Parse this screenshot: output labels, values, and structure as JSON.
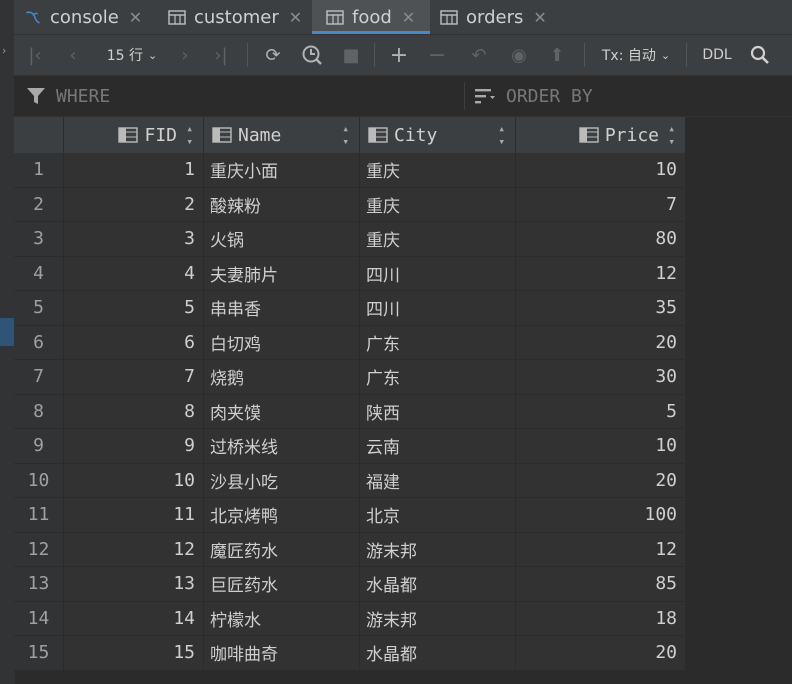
{
  "tabs": [
    {
      "label": "console",
      "icon": "mysql-console-icon",
      "active": false
    },
    {
      "label": "customer",
      "icon": "table-icon",
      "active": false
    },
    {
      "label": "food",
      "icon": "table-icon",
      "active": true
    },
    {
      "label": "orders",
      "icon": "table-icon",
      "active": false
    }
  ],
  "close_glyph": "✕",
  "toolbar": {
    "rows_label": "15 行",
    "tx_label": "Tx: 自动",
    "ddl_label": "DDL"
  },
  "filter": {
    "where_placeholder": "WHERE",
    "orderby_placeholder": "ORDER BY"
  },
  "columns": [
    "FID",
    "Name",
    "City",
    "Price"
  ],
  "rows": [
    {
      "n": "1",
      "fid": "1",
      "name": "重庆小面",
      "city": "重庆",
      "price": "10"
    },
    {
      "n": "2",
      "fid": "2",
      "name": "酸辣粉",
      "city": "重庆",
      "price": "7"
    },
    {
      "n": "3",
      "fid": "3",
      "name": "火锅",
      "city": "重庆",
      "price": "80"
    },
    {
      "n": "4",
      "fid": "4",
      "name": "夫妻肺片",
      "city": "四川",
      "price": "12"
    },
    {
      "n": "5",
      "fid": "5",
      "name": "串串香",
      "city": "四川",
      "price": "35"
    },
    {
      "n": "6",
      "fid": "6",
      "name": "白切鸡",
      "city": "广东",
      "price": "20"
    },
    {
      "n": "7",
      "fid": "7",
      "name": "烧鹅",
      "city": "广东",
      "price": "30"
    },
    {
      "n": "8",
      "fid": "8",
      "name": "肉夹馍",
      "city": "陕西",
      "price": "5"
    },
    {
      "n": "9",
      "fid": "9",
      "name": "过桥米线",
      "city": "云南",
      "price": "10"
    },
    {
      "n": "10",
      "fid": "10",
      "name": "沙县小吃",
      "city": "福建",
      "price": "20"
    },
    {
      "n": "11",
      "fid": "11",
      "name": "北京烤鸭",
      "city": "北京",
      "price": "100"
    },
    {
      "n": "12",
      "fid": "12",
      "name": "魔匠药水",
      "city": "游末邦",
      "price": "12"
    },
    {
      "n": "13",
      "fid": "13",
      "name": "巨匠药水",
      "city": "水晶都",
      "price": "85"
    },
    {
      "n": "14",
      "fid": "14",
      "name": "柠檬水",
      "city": "游末邦",
      "price": "18"
    },
    {
      "n": "15",
      "fid": "15",
      "name": "咖啡曲奇",
      "city": "水晶都",
      "price": "20"
    }
  ]
}
